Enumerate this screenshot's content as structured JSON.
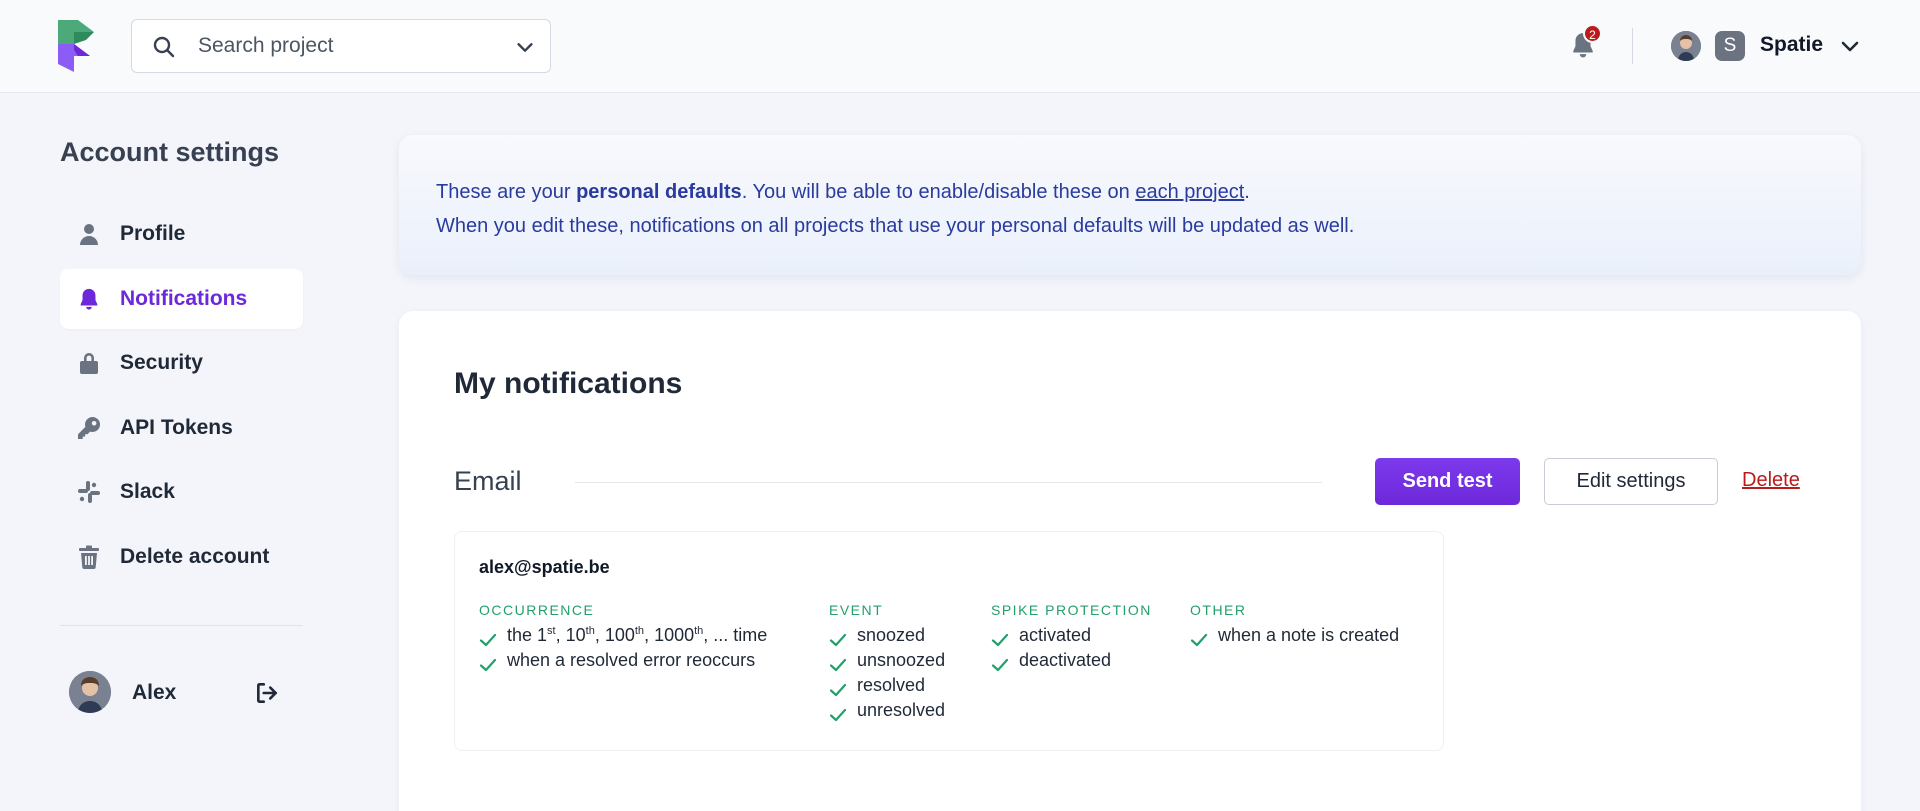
{
  "topbar": {
    "search_placeholder": "Search project",
    "notification_count": "2",
    "team_letter": "S",
    "team_name": "Spatie"
  },
  "sidebar": {
    "title": "Account settings",
    "items": [
      {
        "label": "Profile",
        "icon": "user-icon",
        "active": false
      },
      {
        "label": "Notifications",
        "icon": "bell-icon",
        "active": true
      },
      {
        "label": "Security",
        "icon": "lock-icon",
        "active": false
      },
      {
        "label": "API Tokens",
        "icon": "key-icon",
        "active": false
      },
      {
        "label": "Slack",
        "icon": "slack-icon",
        "active": false
      },
      {
        "label": "Delete account",
        "icon": "trash-icon",
        "active": false
      }
    ],
    "user_name": "Alex"
  },
  "banner": {
    "line1_prefix": "These are your ",
    "line1_bold": "personal defaults",
    "line1_middle": ". You will be able to enable/disable these on ",
    "line1_link": "each project",
    "line1_suffix": ".",
    "line2": "When you edit these, notifications on all projects that use your personal defaults will be updated as well."
  },
  "notifications": {
    "title": "My notifications",
    "channel": "Email",
    "send_test_label": "Send test",
    "edit_settings_label": "Edit settings",
    "delete_label": "Delete",
    "email": "alex@spatie.be",
    "columns": [
      {
        "heading": "OCCURRENCE",
        "rows": [
          "when a resolved error reoccurs"
        ]
      },
      {
        "heading": "EVENT",
        "rows": [
          "snoozed",
          "unsnoozed",
          "resolved",
          "unresolved"
        ]
      },
      {
        "heading": "SPIKE PROTECTION",
        "rows": [
          "activated",
          "deactivated"
        ]
      },
      {
        "heading": "OTHER",
        "rows": [
          "when a note is created"
        ]
      }
    ],
    "occurrence_first": {
      "the": "the 1",
      "st": "st",
      "c1": ", 10",
      "th1": "th",
      "c2": ", 100",
      "th2": "th",
      "c3": ", 1000",
      "th3": "th",
      "tail": ", ... time"
    }
  },
  "colors": {
    "accent": "#6d28d9",
    "banner_text": "#2a3b9e",
    "check": "#22a06b",
    "danger": "#b91c1c"
  }
}
